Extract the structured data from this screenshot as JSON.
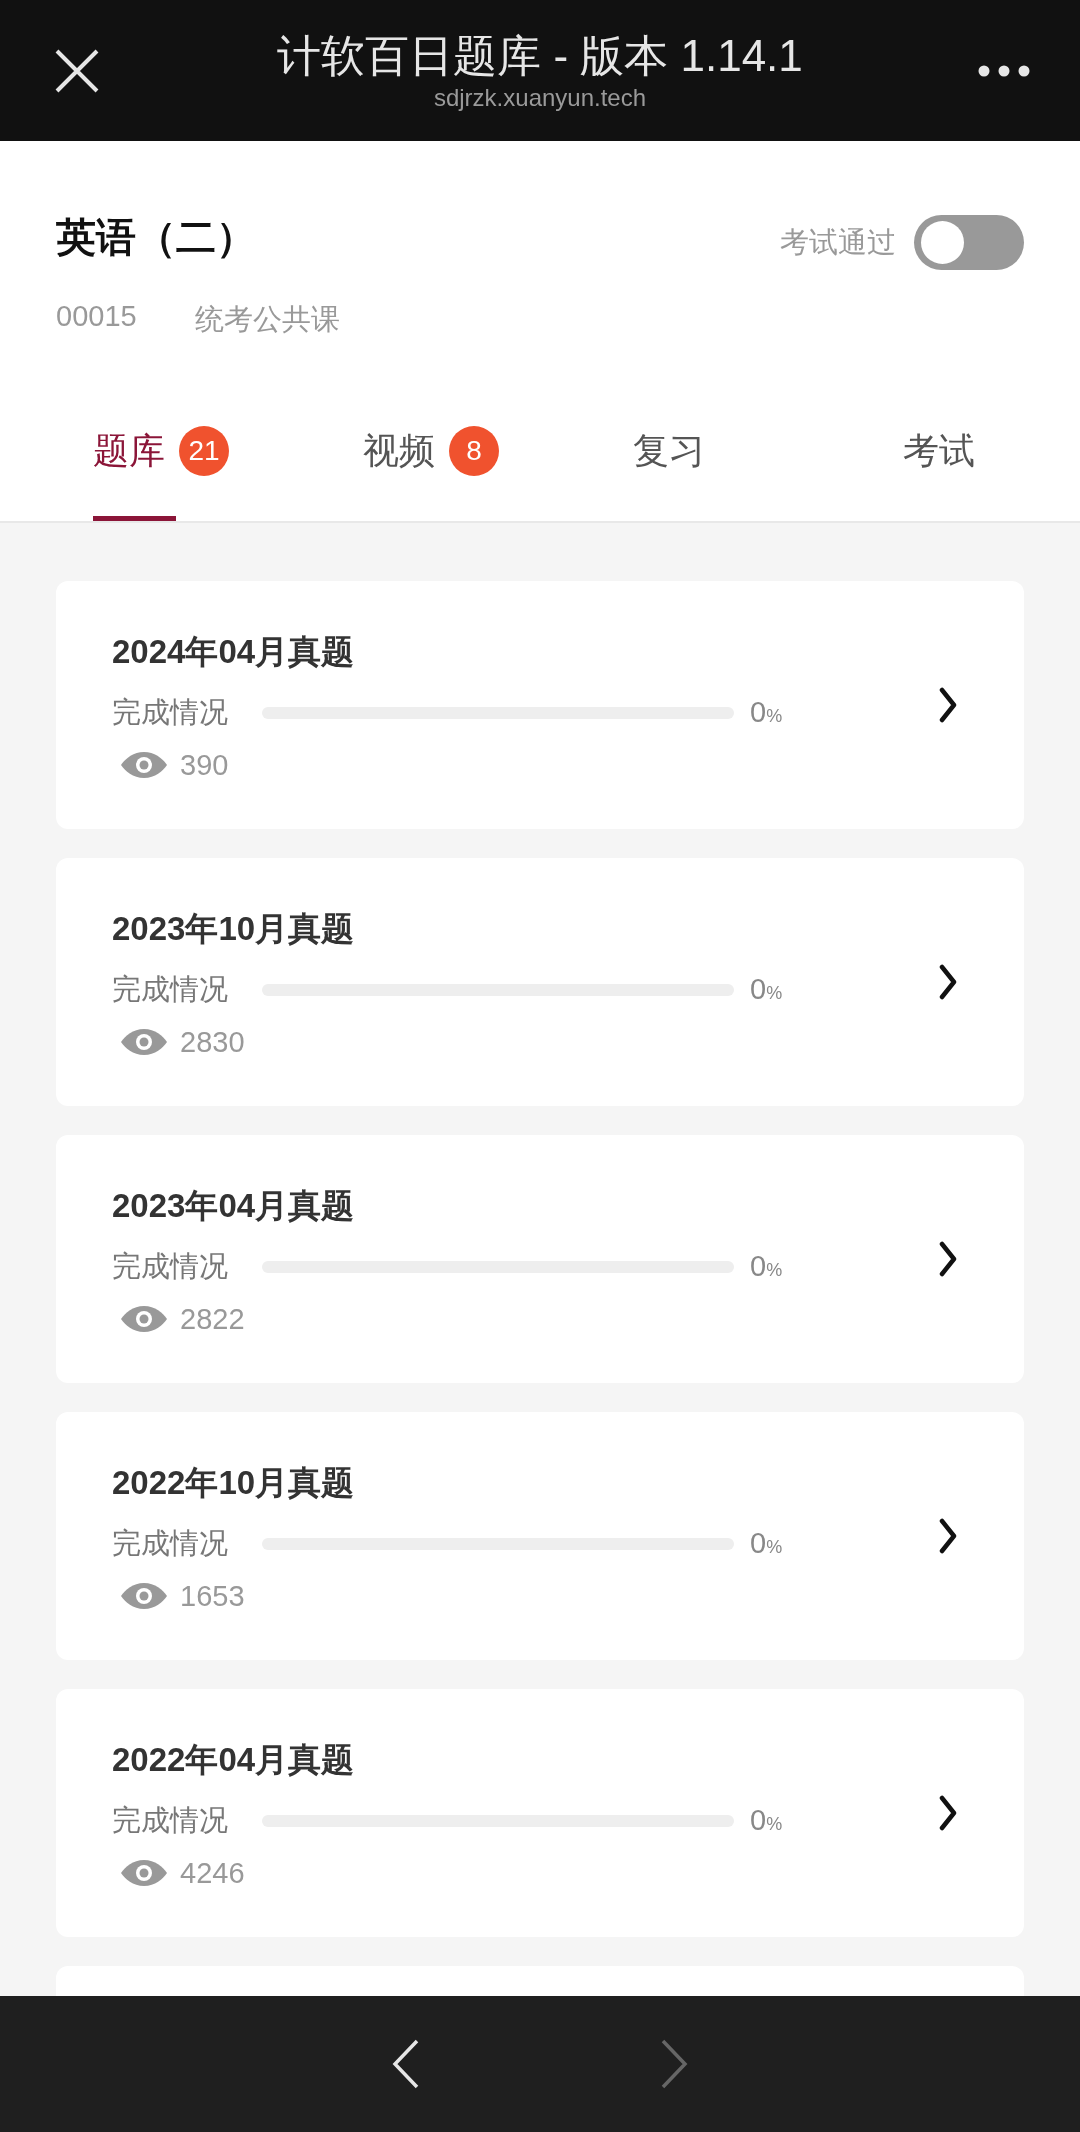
{
  "header": {
    "title": "计软百日题库 - 版本 1.14.1",
    "url": "sdjrzk.xuanyun.tech"
  },
  "course": {
    "title": "英语（二）",
    "code": "00015",
    "category": "统考公共课",
    "passed_label": "考试通过",
    "passed": false
  },
  "tabs": [
    {
      "label": "题库",
      "badge": "21",
      "selected": true
    },
    {
      "label": "视频",
      "badge": "8",
      "selected": false
    },
    {
      "label": "复习",
      "selected": false
    },
    {
      "label": "考试",
      "selected": false
    }
  ],
  "papers": [
    {
      "title": "2024年04月真题",
      "progress_label": "完成情况",
      "level": 0,
      "percent": "0",
      "percent_sign": "%",
      "views": "390"
    },
    {
      "title": "2023年10月真题",
      "progress_label": "完成情况",
      "level": 0,
      "percent": "0",
      "percent_sign": "%",
      "views": "2830"
    },
    {
      "title": "2023年04月真题",
      "progress_label": "完成情况",
      "level": 0,
      "percent": "0",
      "percent_sign": "%",
      "views": "2822"
    },
    {
      "title": "2022年10月真题",
      "progress_label": "完成情况",
      "level": 0,
      "percent": "0",
      "percent_sign": "%",
      "views": "1653"
    },
    {
      "title": "2022年04月真题",
      "progress_label": "完成情况",
      "level": 0,
      "percent": "0",
      "percent_sign": "%",
      "views": "4246"
    }
  ],
  "nav": {
    "back_disabled": false,
    "forward_disabled": true
  }
}
